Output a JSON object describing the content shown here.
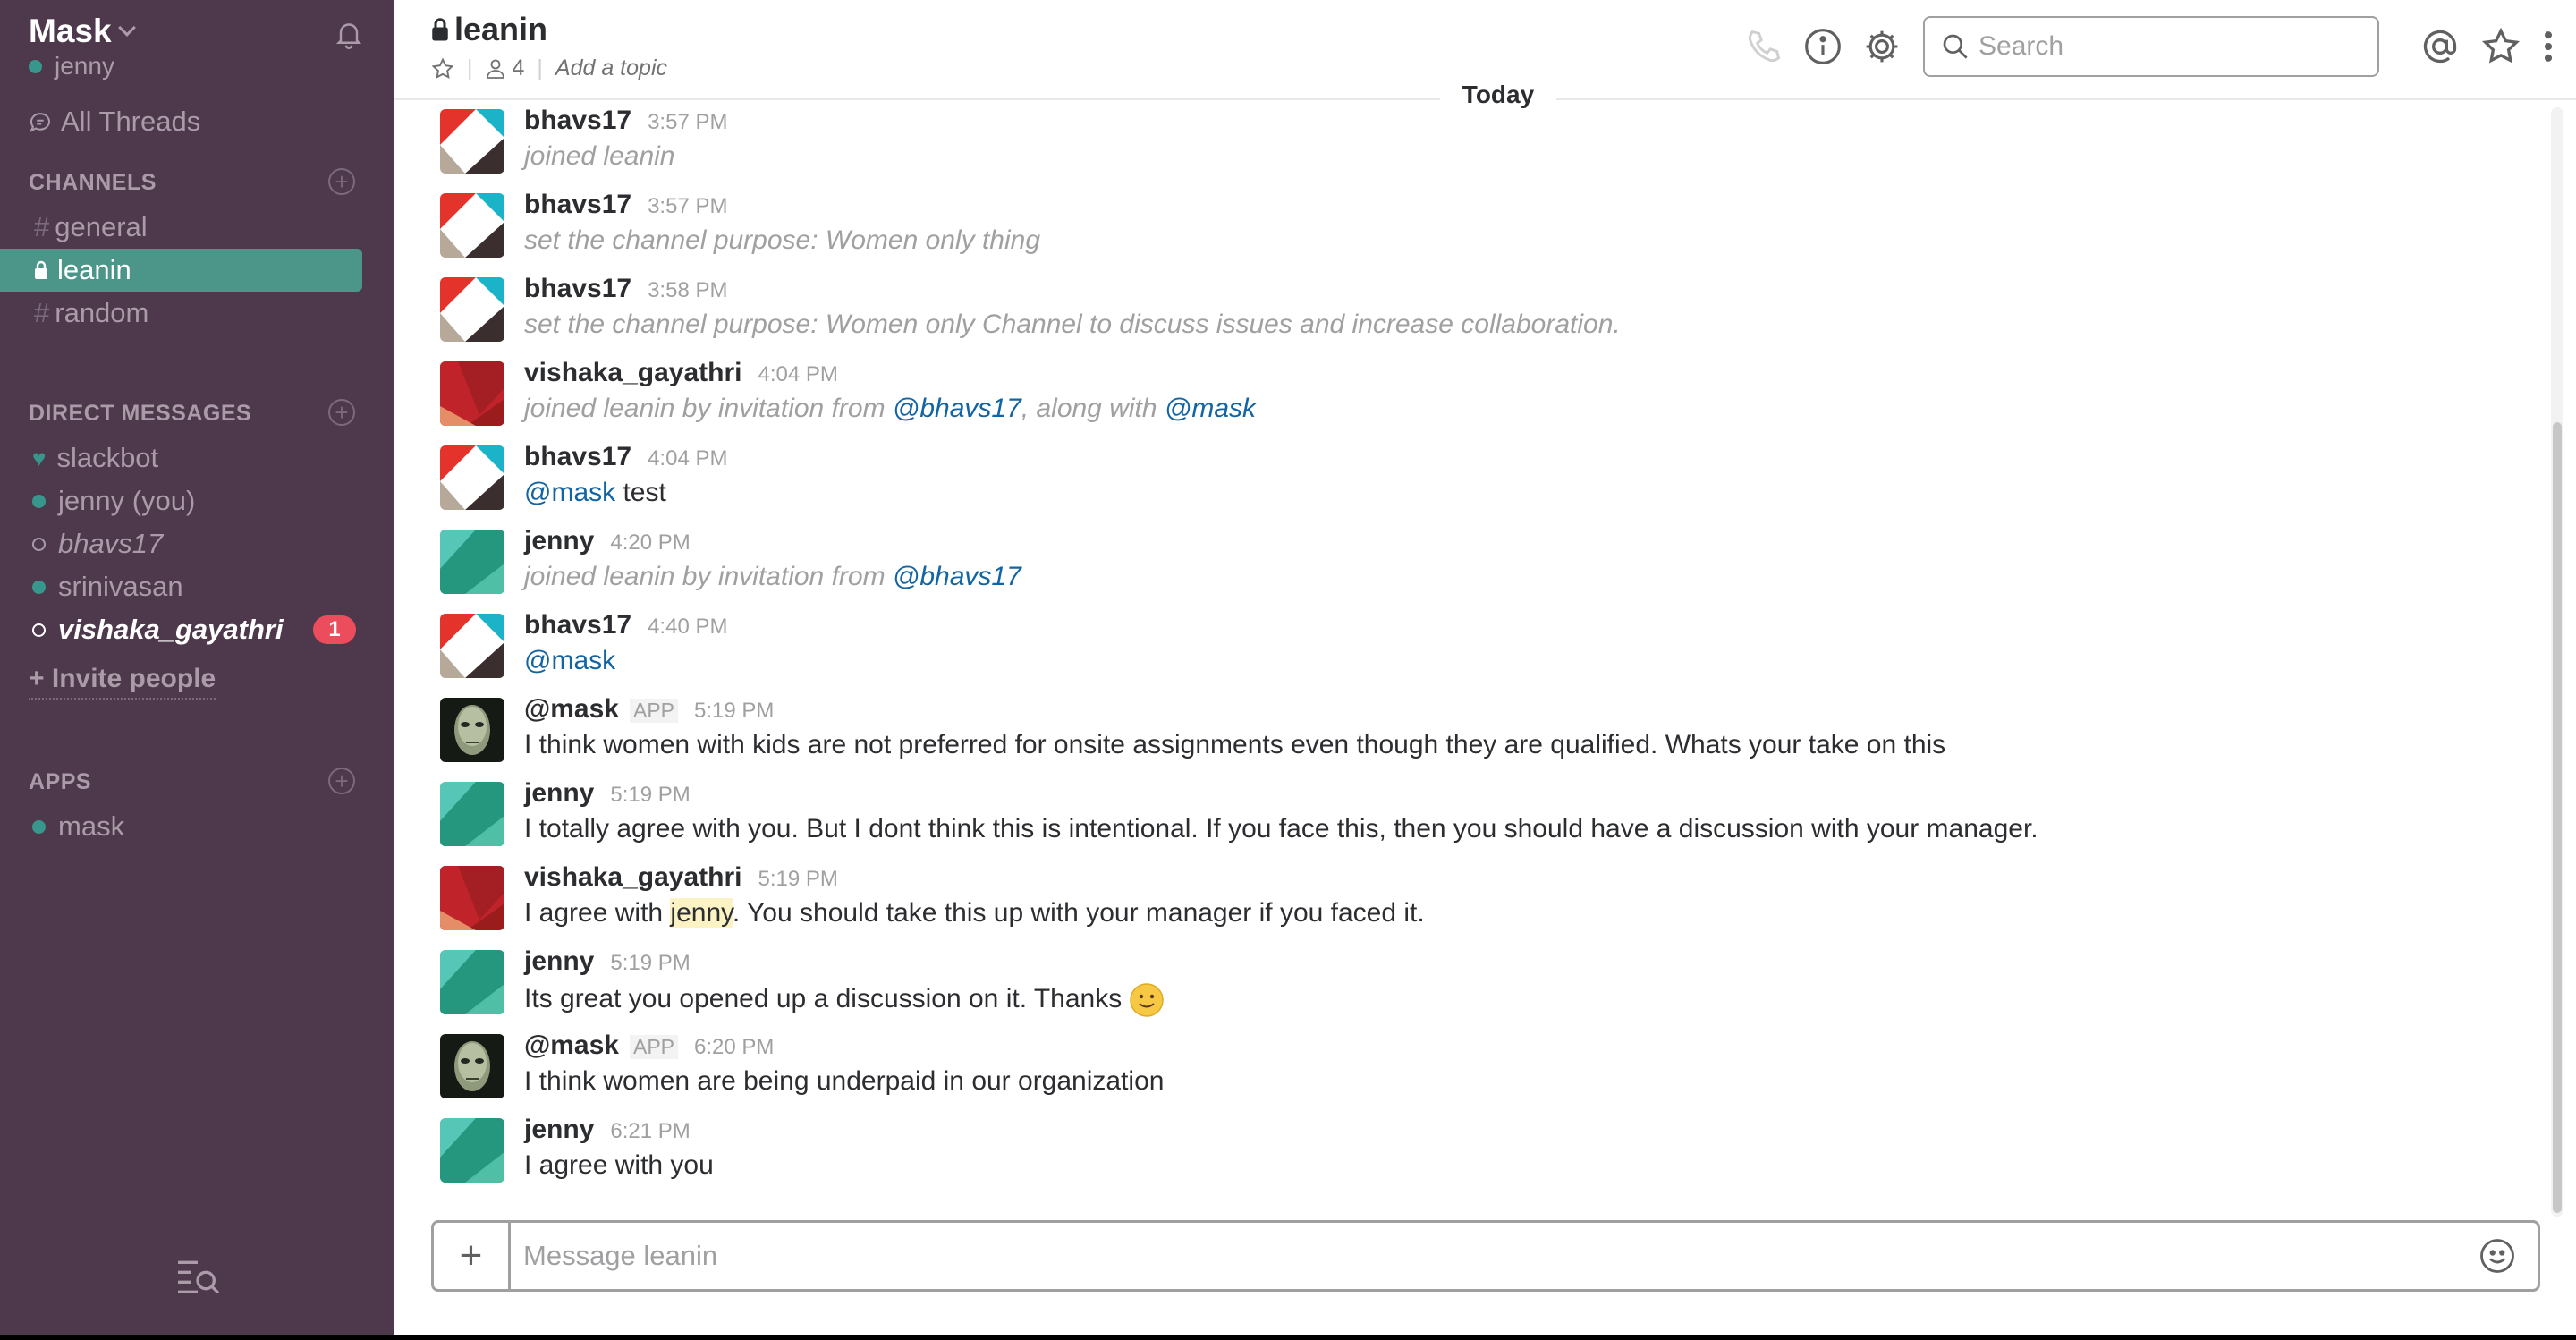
{
  "sidebar": {
    "team_name": "Mask",
    "user": "jenny",
    "all_threads": "All Threads",
    "channels_heading": "CHANNELS",
    "channels": [
      {
        "name": "general"
      },
      {
        "name": "leanin"
      },
      {
        "name": "random"
      }
    ],
    "dm_heading": "DIRECT MESSAGES",
    "dms": [
      {
        "name": "slackbot"
      },
      {
        "name": "jenny (you)"
      },
      {
        "name": "bhavs17"
      },
      {
        "name": "srinivasan"
      },
      {
        "name": "vishaka_gayathri",
        "badge": "1"
      }
    ],
    "invite": "+ Invite people",
    "apps_heading": "APPS",
    "apps": [
      {
        "name": "mask"
      }
    ]
  },
  "header": {
    "channel": "leanin",
    "members": "4",
    "topic": "Add a topic",
    "search_placeholder": "Search"
  },
  "day_divider": "Today",
  "messages": [
    {
      "author": "bhavs17",
      "time": "3:57 PM",
      "text": "joined leanin"
    },
    {
      "author": "bhavs17",
      "time": "3:57 PM",
      "text": "set the channel purpose: Women only thing"
    },
    {
      "author": "bhavs17",
      "time": "3:58 PM",
      "text": "set the channel purpose: Women only Channel to discuss issues and increase collaboration."
    },
    {
      "author": "vishaka_gayathri",
      "time": "4:04 PM",
      "text_a": "joined leanin by invitation from ",
      "mention_a": "@bhavs17",
      "text_b": ", along with ",
      "mention_b": "@mask"
    },
    {
      "author": "bhavs17",
      "time": "4:04 PM",
      "mention": "@mask",
      "text": " test"
    },
    {
      "author": "jenny",
      "time": "4:20 PM",
      "text": "joined leanin by invitation from ",
      "mention": "@bhavs17"
    },
    {
      "author": "bhavs17",
      "time": "4:40 PM",
      "mention": "@mask"
    },
    {
      "author": "@mask",
      "app_tag": "APP",
      "time": "5:19 PM",
      "text": "I think women with kids are not preferred for onsite assignments even though they are qualified. Whats your take on this"
    },
    {
      "author": "jenny",
      "time": "5:19 PM",
      "text": "I totally agree with you. But I dont think this is intentional. If you face this, then you should have a discussion with your manager."
    },
    {
      "author": "vishaka_gayathri",
      "time": "5:19 PM",
      "text_a": "I agree with ",
      "highlight": "jenny",
      "text_b": ". You should take this up with your manager if you faced it."
    },
    {
      "author": "jenny",
      "time": "5:19 PM",
      "text": "Its great you opened up a discussion on it. Thanks"
    },
    {
      "author": "@mask",
      "app_tag": "APP",
      "time": "6:20 PM",
      "text": "I think women are being underpaid in our organization"
    },
    {
      "author": "jenny",
      "time": "6:21 PM",
      "text": "I agree with you"
    }
  ],
  "composer": {
    "placeholder": "Message leanin"
  },
  "icons": [
    "bell-icon",
    "threads-icon",
    "lock-icon",
    "star-icon",
    "member-icon",
    "phone-icon",
    "info-icon",
    "gear-icon",
    "search-icon",
    "at-icon",
    "more-icon",
    "smile-icon",
    "plus-icon",
    "search-list-icon"
  ],
  "colors": {
    "sidebar": "#4d394b",
    "active_channel": "#4c9689",
    "presence": "#38978d",
    "badge": "#eb4d5c",
    "mention": "#1264a3"
  }
}
